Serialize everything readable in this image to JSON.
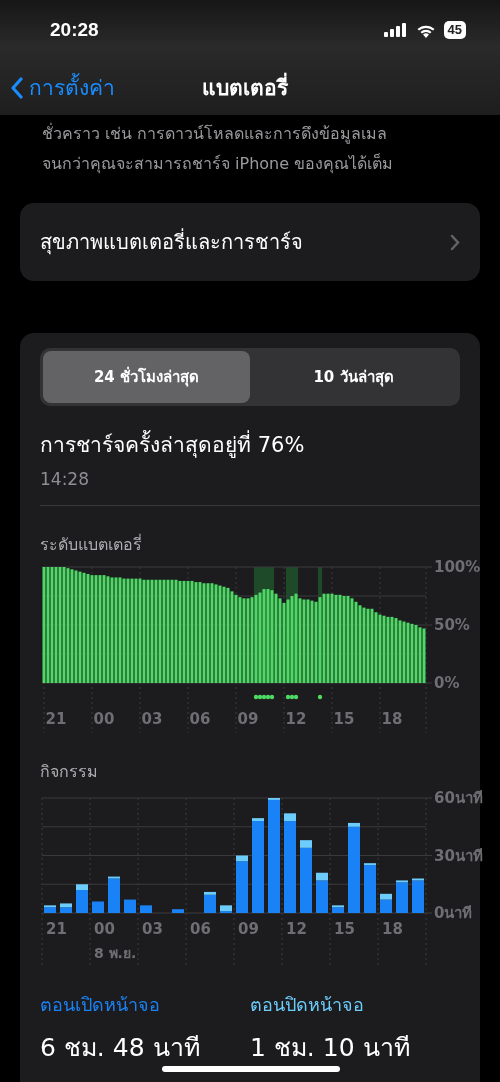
{
  "status_bar": {
    "time": "20:28",
    "battery": "45"
  },
  "nav": {
    "back": "การตั้งค่า",
    "title": "แบตเตอรี่"
  },
  "intro": "ชั่วคราว เช่น การดาวน์โหลดและการดึงข้อมูลเมล จนกว่าคุณจะสามารถชาร์จ iPhone ของคุณได้เต็ม",
  "health_row": {
    "label": "สุขภาพแบตเตอรี่และการชาร์จ"
  },
  "tabs": [
    {
      "label": "24 ชั่วโมงล่าสุด",
      "selected": true
    },
    {
      "label": "10 วันล่าสุด",
      "selected": false
    }
  ],
  "last_charge": {
    "title": "การชาร์จครั้งล่าสุดอยู่ที่ 76%",
    "time": "14:28"
  },
  "battery_level": {
    "title": "ระดับแบตเตอรี่",
    "chart_data": {
      "type": "bar",
      "grid": true,
      "categories": [
        null,
        null,
        null,
        "21",
        null,
        null,
        null,
        null,
        null,
        null,
        null,
        null,
        null,
        null,
        null,
        "00",
        null,
        null,
        null,
        null,
        null,
        null,
        null,
        null,
        null,
        null,
        null,
        "03",
        null,
        null,
        null,
        null,
        null,
        null,
        null,
        null,
        null,
        null,
        null,
        "06",
        null,
        null,
        null,
        null,
        null,
        null,
        null,
        null,
        null,
        null,
        null,
        "09",
        null,
        null,
        null,
        null,
        null,
        null,
        null,
        null,
        null,
        null,
        null,
        "12",
        null,
        null,
        null,
        null,
        null,
        null,
        null,
        null,
        null,
        null,
        null,
        "15",
        null,
        null,
        null,
        null,
        null,
        null,
        null,
        null,
        null,
        null,
        null,
        "18",
        null,
        null,
        null,
        null,
        null,
        null,
        null,
        null
      ],
      "values": [
        100,
        100,
        100,
        100,
        100,
        100,
        99,
        98,
        97,
        96,
        95,
        94,
        93,
        93,
        93,
        93,
        92,
        91,
        91,
        91,
        90,
        90,
        90,
        90,
        90,
        89,
        89,
        89,
        89,
        89,
        89,
        89,
        89,
        89,
        88,
        88,
        88,
        88,
        87,
        87,
        86,
        86,
        86,
        85,
        84,
        83,
        82,
        79,
        76,
        74,
        73,
        73,
        74,
        76,
        78,
        81,
        81,
        80,
        77,
        73,
        69,
        72,
        75,
        77,
        73,
        72,
        72,
        71,
        70,
        74,
        77,
        77,
        77,
        76,
        76,
        75,
        75,
        73,
        70,
        67,
        65,
        64,
        64,
        61,
        59,
        58,
        57,
        57,
        56,
        54,
        53,
        52,
        51,
        50,
        48,
        47
      ],
      "ylim": [
        0,
        100
      ],
      "yticks": [
        {
          "value": 0,
          "label": "0%"
        },
        {
          "value": 50,
          "label": "50%"
        },
        {
          "value": 100,
          "label": "100%"
        }
      ]
    },
    "charging": [
      false,
      false,
      false,
      false,
      false,
      false,
      false,
      false,
      false,
      false,
      false,
      false,
      false,
      false,
      false,
      false,
      false,
      false,
      false,
      false,
      false,
      false,
      false,
      false,
      false,
      false,
      false,
      false,
      false,
      false,
      false,
      false,
      false,
      false,
      false,
      false,
      false,
      false,
      false,
      false,
      false,
      false,
      false,
      false,
      false,
      false,
      false,
      false,
      false,
      false,
      false,
      false,
      false,
      true,
      true,
      true,
      true,
      true,
      false,
      false,
      false,
      true,
      true,
      true,
      false,
      false,
      false,
      false,
      false,
      true,
      false,
      false,
      false,
      false,
      false,
      false,
      false,
      false,
      false,
      false,
      false,
      false,
      false,
      false,
      false,
      false,
      false,
      false,
      false,
      false,
      false,
      false,
      false,
      false,
      false,
      false
    ]
  },
  "activity": {
    "title": "กิจกรรม",
    "date_label": "8 พ.ย.",
    "chart_data": {
      "type": "bar",
      "stacked": true,
      "grid": true,
      "categories": [
        "21",
        null,
        null,
        "00",
        null,
        null,
        "03",
        null,
        null,
        "06",
        null,
        null,
        "09",
        null,
        null,
        "12",
        null,
        null,
        "15",
        null,
        null,
        "18",
        null,
        null
      ],
      "series": [
        {
          "name": "ตอนเปิดหน้าจอ",
          "color": "#1a82f7",
          "values": [
            3,
            3,
            12,
            6,
            18,
            7,
            4,
            0,
            2,
            0,
            9.5,
            1,
            27,
            48,
            59,
            48,
            34,
            17,
            3,
            45,
            25,
            7,
            16,
            17
          ]
        },
        {
          "name": "ตอนปิดหน้าจอ",
          "color": "#6ccdfc",
          "values": [
            1,
            2,
            3,
            0,
            1,
            0,
            0,
            0,
            0,
            0,
            1.5,
            3,
            3,
            1.5,
            1,
            4,
            4,
            4,
            1,
            2,
            1,
            3,
            1,
            1
          ]
        }
      ],
      "ylim": [
        0,
        60
      ],
      "yticks": [
        {
          "value": 0,
          "label": "0นาที"
        },
        {
          "value": 30,
          "label": "30นาที"
        },
        {
          "value": 60,
          "label": "60นาที"
        }
      ]
    }
  },
  "usage": [
    "6 ชม. 48 นาที",
    "1 ชม. 10 นาที"
  ]
}
